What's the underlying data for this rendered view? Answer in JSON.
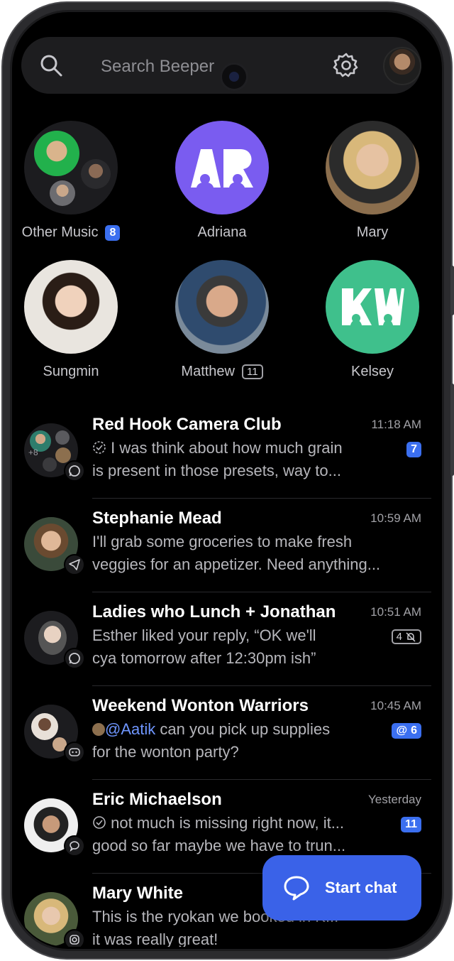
{
  "search": {
    "placeholder": "Search Beeper"
  },
  "favorites": [
    {
      "name": "Other Music",
      "badge": "8",
      "badge_style": "blue"
    },
    {
      "name": "Adriana",
      "initials_logo": "AR",
      "color": "#7a5cf0"
    },
    {
      "name": "Mary"
    },
    {
      "name": "Sungmin"
    },
    {
      "name": "Matthew",
      "badge": "11",
      "badge_style": "outline"
    },
    {
      "name": "Kelsey",
      "color": "#3fc08c"
    }
  ],
  "chats": [
    {
      "name": "Red Hook Camera Club",
      "time": "11:18 AM",
      "line1": "I was think about how much grain",
      "line2": "is present in those presets, way to...",
      "badge": "7",
      "network": "whatsapp-icon",
      "group_more": "+8"
    },
    {
      "name": "Stephanie Mead",
      "time": "10:59 AM",
      "line1": "I'll grab some groceries to make fresh",
      "line2": "veggies for an appetizer. Need anything...",
      "network": "telegram-icon"
    },
    {
      "name": "Ladies who Lunch + Jonathan",
      "time": "10:51 AM",
      "line1": "Esther liked your reply, “OK we'll",
      "line2": "cya tomorrow after 12:30pm ish”",
      "badge": "4",
      "network": "whatsapp-icon"
    },
    {
      "name": "Weekend Wonton Warriors",
      "time": "10:45 AM",
      "mention": "@Aatik",
      "line1": " can you pick up supplies",
      "line2": "for the wonton party?",
      "badge": "6",
      "network": "discord-icon"
    },
    {
      "name": "Eric Michaelson",
      "time": "Yesterday",
      "line1": "not much is missing right now, it...",
      "line2": "good so far maybe we have to trun...",
      "badge": "11",
      "network": "imessage-icon"
    },
    {
      "name": "Mary White",
      "line1": "This is the ryokan we booked in K...",
      "line2": "it was really great!",
      "network": "instagram-icon"
    }
  ],
  "start_chat": {
    "label": "Start chat"
  },
  "colors": {
    "accent": "#3b6ff0",
    "background": "#000000"
  }
}
